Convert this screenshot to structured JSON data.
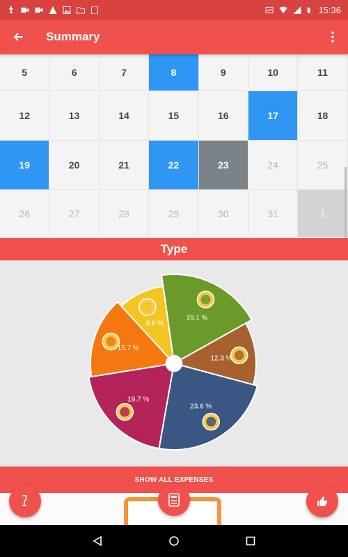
{
  "status_bar": {
    "time": "15:36",
    "icons": [
      "usb-icon",
      "video-icon",
      "video-icon",
      "warning-icon",
      "image-icon",
      "folder-icon",
      "sd-card-icon",
      "cast-icon",
      "wifi-icon",
      "signal-icon",
      "battery-icon"
    ]
  },
  "app_bar": {
    "title": "Summary",
    "back_icon": "arrow-back-icon",
    "menu_icon": "more-vert-icon"
  },
  "calendar": {
    "rows": [
      [
        {
          "day": "5",
          "state": "normal"
        },
        {
          "day": "6",
          "state": "normal"
        },
        {
          "day": "7",
          "state": "normal"
        },
        {
          "day": "8",
          "state": "selected"
        },
        {
          "day": "9",
          "state": "normal"
        },
        {
          "day": "10",
          "state": "normal"
        },
        {
          "day": "11",
          "state": "normal"
        }
      ],
      [
        {
          "day": "12",
          "state": "normal"
        },
        {
          "day": "13",
          "state": "normal"
        },
        {
          "day": "14",
          "state": "normal"
        },
        {
          "day": "15",
          "state": "normal"
        },
        {
          "day": "16",
          "state": "normal"
        },
        {
          "day": "17",
          "state": "selected"
        },
        {
          "day": "18",
          "state": "normal"
        }
      ],
      [
        {
          "day": "19",
          "state": "selected"
        },
        {
          "day": "20",
          "state": "normal"
        },
        {
          "day": "21",
          "state": "normal"
        },
        {
          "day": "22",
          "state": "selected"
        },
        {
          "day": "23",
          "state": "today"
        },
        {
          "day": "24",
          "state": "muted"
        },
        {
          "day": "25",
          "state": "muted"
        }
      ],
      [
        {
          "day": "26",
          "state": "muted"
        },
        {
          "day": "27",
          "state": "muted"
        },
        {
          "day": "28",
          "state": "muted"
        },
        {
          "day": "29",
          "state": "muted"
        },
        {
          "day": "30",
          "state": "muted"
        },
        {
          "day": "31",
          "state": "muted"
        },
        {
          "day": "1",
          "state": "disabled"
        }
      ]
    ]
  },
  "type_section": {
    "title": "Type"
  },
  "chart_data": {
    "type": "pie",
    "slices": [
      {
        "value": 19.1,
        "label": "19.1 %",
        "color": "#6a9a2a",
        "icon": "tag-icon"
      },
      {
        "value": 12.3,
        "label": "12.3 %",
        "color": "#a8602f",
        "icon": "cloud-icon"
      },
      {
        "value": 23.6,
        "label": "23.6 %",
        "color": "#3a5683",
        "icon": "money-bag-icon"
      },
      {
        "value": 19.7,
        "label": "19.7 %",
        "color": "#b3245a",
        "icon": "car-icon"
      },
      {
        "value": 15.7,
        "label": "15.7 %",
        "color": "#f4770f",
        "icon": "cart-icon"
      },
      {
        "value": 9.6,
        "label": "9.6 %",
        "color": "#f2c521",
        "icon": "car-icon"
      }
    ]
  },
  "footer": {
    "show_all_label": "SHOW ALL EXPENSES"
  },
  "fabs": {
    "left_icon": "wine-glass-icon",
    "center_icon": "calculator-icon",
    "right_icon": "thumbs-up-icon"
  },
  "nav": {
    "back_icon": "nav-back-icon",
    "home_icon": "nav-home-icon",
    "recents_icon": "nav-recents-icon"
  }
}
